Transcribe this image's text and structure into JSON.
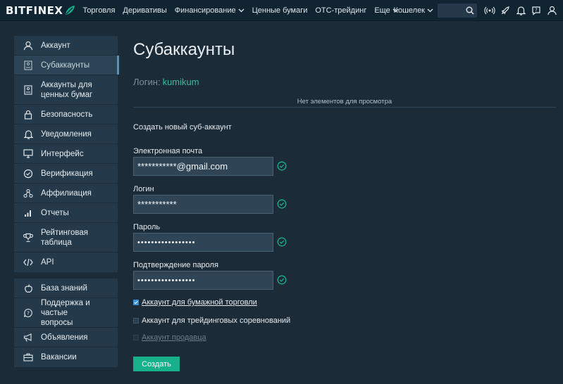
{
  "brand": {
    "name": "BITFINEX"
  },
  "nav": {
    "items": [
      {
        "label": "Торговля",
        "dropdown": false
      },
      {
        "label": "Деривативы",
        "dropdown": false
      },
      {
        "label": "Финансирование",
        "dropdown": true
      },
      {
        "label": "Ценные бумаги",
        "dropdown": false
      },
      {
        "label": "OTC-трейдинг",
        "dropdown": false
      },
      {
        "label": "Еще",
        "dropdown": true
      }
    ],
    "wallet_label": "Кошелек",
    "right_icons": [
      "broadcast-icon",
      "rocket-icon",
      "bell-icon",
      "help-icon",
      "user-icon"
    ]
  },
  "sidebar": {
    "groups": [
      [
        {
          "label": "Аккаунт",
          "icon": "user-icon"
        },
        {
          "label": "Субаккаунты",
          "icon": "subaccount-icon",
          "active": true
        },
        {
          "label": "Аккаунты для ценных бумаг",
          "icon": "securities-icon"
        },
        {
          "label": "Безопасность",
          "icon": "lock-icon"
        },
        {
          "label": "Уведомления",
          "icon": "bell-icon"
        },
        {
          "label": "Интерфейс",
          "icon": "monitor-icon"
        },
        {
          "label": "Верификация",
          "icon": "check-circle-icon"
        },
        {
          "label": "Аффилиация",
          "icon": "affiliate-icon"
        },
        {
          "label": "Отчеты",
          "icon": "bar-chart-icon"
        },
        {
          "label": "Рейтинговая таблица",
          "icon": "trophy-icon"
        },
        {
          "label": "API",
          "icon": "code-icon"
        }
      ],
      [
        {
          "label": "База знаний",
          "icon": "apple-icon"
        },
        {
          "label": "Поддержка и частые вопросы",
          "icon": "support-icon"
        },
        {
          "label": "Объявления",
          "icon": "megaphone-icon"
        },
        {
          "label": "Вакансии",
          "icon": "briefcase-icon"
        }
      ]
    ]
  },
  "main": {
    "title": "Субаккаунты",
    "login_label": "Логин:",
    "login_value": "kumikum",
    "empty_text": "Нет элементов для просмотра",
    "section_title": "Создать новый суб-аккаунт",
    "fields": [
      {
        "label": "Электронная почта",
        "value": "***********@gmail.com"
      },
      {
        "label": "Логин",
        "value": "***********"
      },
      {
        "label": "Пароль",
        "value": "•••••••••••••••••"
      },
      {
        "label": "Подтверждение пароля",
        "value": "•••••••••••••••••"
      }
    ],
    "checkboxes": [
      {
        "label": "Аккаунт для бумажной торговли",
        "checked": true,
        "disabled": false,
        "underline": true
      },
      {
        "label": "Аккаунт для трейдинговых соревнований",
        "checked": false,
        "disabled": false,
        "underline": false
      },
      {
        "label": "Аккаунт продавца",
        "checked": false,
        "disabled": true,
        "underline": true
      }
    ],
    "submit_label": "Создать"
  },
  "colors": {
    "accent": "#16b08b",
    "background": "#1b2b38",
    "panel": "#243a4a",
    "link": "#3fb89a"
  }
}
